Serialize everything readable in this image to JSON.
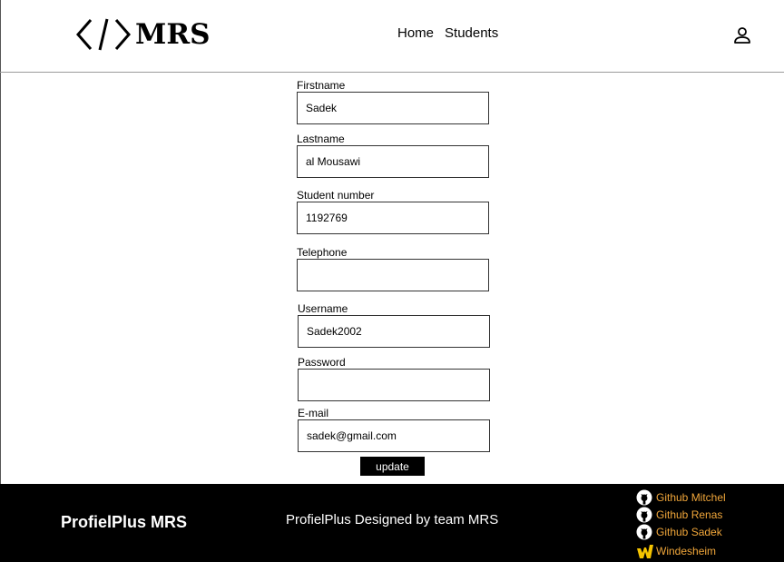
{
  "header": {
    "logo_text": "MRS",
    "nav": [
      {
        "label": "Home"
      },
      {
        "label": "Students"
      }
    ]
  },
  "form": {
    "fields": [
      {
        "label": "Firstname",
        "value": "Sadek"
      },
      {
        "label": "Lastname",
        "value": "al Mousawi"
      },
      {
        "label": "Student number",
        "value": "1192769"
      },
      {
        "label": "Telephone",
        "value": ""
      },
      {
        "label": "Username",
        "value": "Sadek2002"
      },
      {
        "label": "Password",
        "value": ""
      },
      {
        "label": "E-mail",
        "value": "sadek@gmail.com"
      }
    ],
    "submit_label": "update"
  },
  "footer": {
    "brand": "ProfielPlus MRS",
    "credit": "ProfielPlus Designed by team MRS",
    "links": [
      {
        "label": "Github Mitchel",
        "icon": "github-icon"
      },
      {
        "label": "Github Renas",
        "icon": "github-icon"
      },
      {
        "label": "Github Sadek",
        "icon": "github-icon"
      },
      {
        "label": "Windesheim",
        "icon": "windesheim-icon"
      }
    ],
    "link_color": "#f0a63a"
  }
}
